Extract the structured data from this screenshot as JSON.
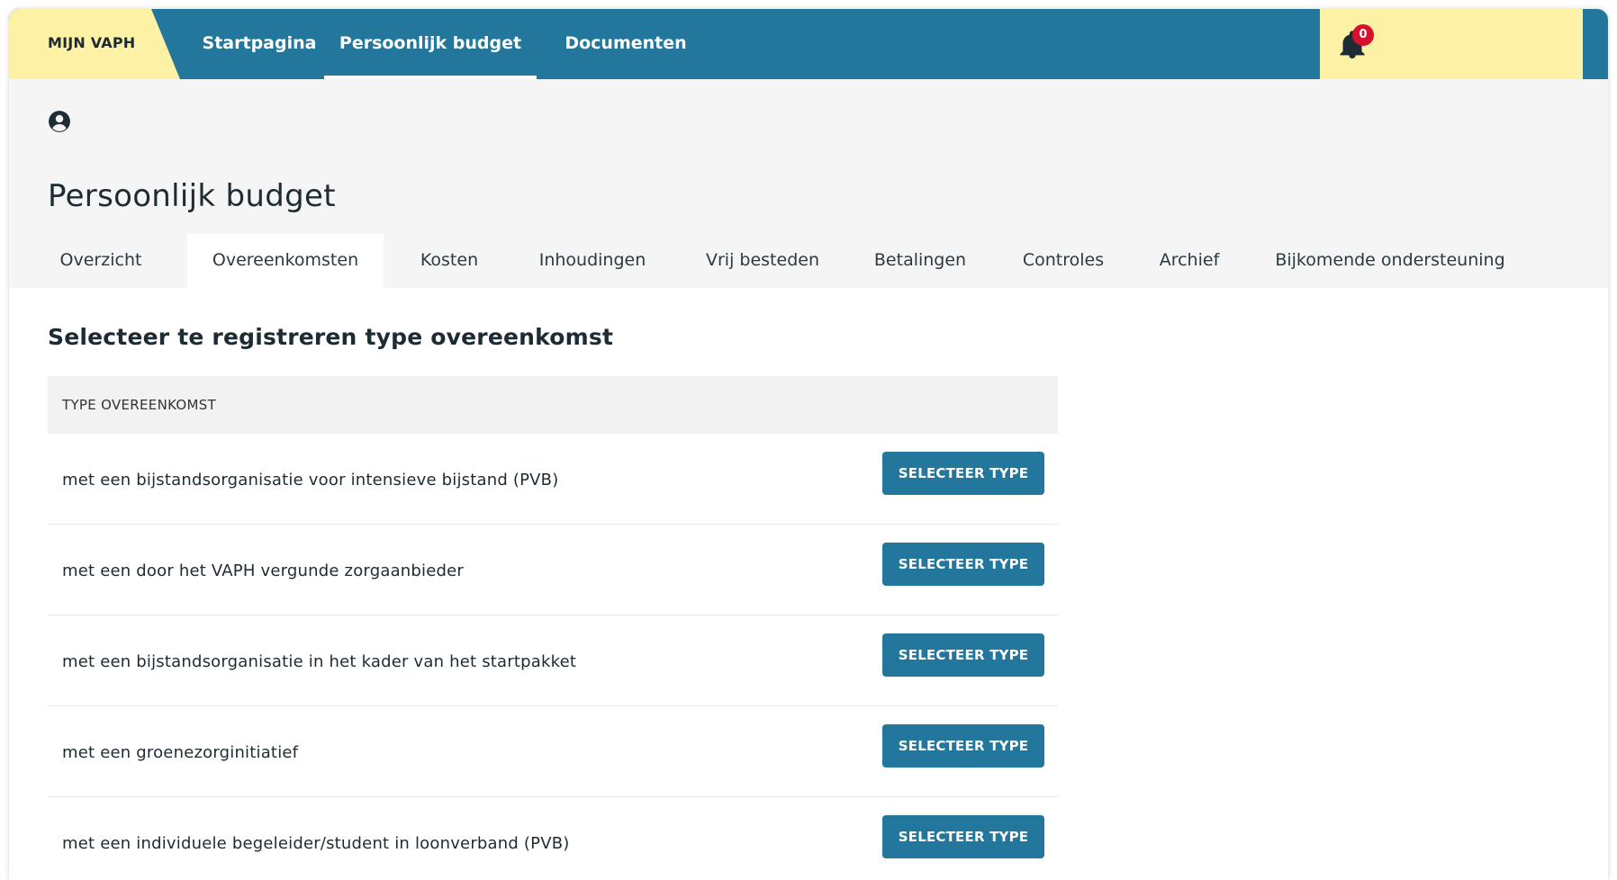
{
  "topnav": {
    "brand": "MIJN VAPH",
    "items": [
      {
        "label": "Startpagina"
      },
      {
        "label": "Persoonlijk budget",
        "active": true
      },
      {
        "label": "Documenten"
      }
    ],
    "notifications": {
      "count": "0"
    }
  },
  "header": {
    "title": "Persoonlijk budget",
    "tabs": [
      {
        "label": "Overzicht"
      },
      {
        "label": "Overeenkomsten",
        "active": true
      },
      {
        "label": "Kosten"
      },
      {
        "label": "Inhoudingen"
      },
      {
        "label": "Vrij besteden"
      },
      {
        "label": "Betalingen"
      },
      {
        "label": "Controles"
      },
      {
        "label": "Archief"
      },
      {
        "label": "Bijkomende ondersteuning"
      }
    ]
  },
  "main": {
    "section_title": "Selecteer te registreren type overeenkomst",
    "table": {
      "header": "TYPE OVEREENKOMST",
      "button_label": "SELECTEER TYPE",
      "rows": [
        {
          "label": "met een bijstandsorganisatie voor intensieve bijstand (PVB)"
        },
        {
          "label": "met een door het VAPH vergunde zorgaanbieder"
        },
        {
          "label": "met een bijstandsorganisatie in het kader van het startpakket"
        },
        {
          "label": "met een groenezorginitiatief"
        },
        {
          "label": "met een individuele begeleider/student in loonverband (PVB)"
        }
      ]
    }
  },
  "colors": {
    "primary": "#23779c",
    "accent_yellow": "#fdf1a5",
    "badge_red": "#d7102d",
    "header_bg": "#f5f5f5"
  },
  "icons": {
    "notification": "bell-icon",
    "user": "user-circle-icon"
  }
}
